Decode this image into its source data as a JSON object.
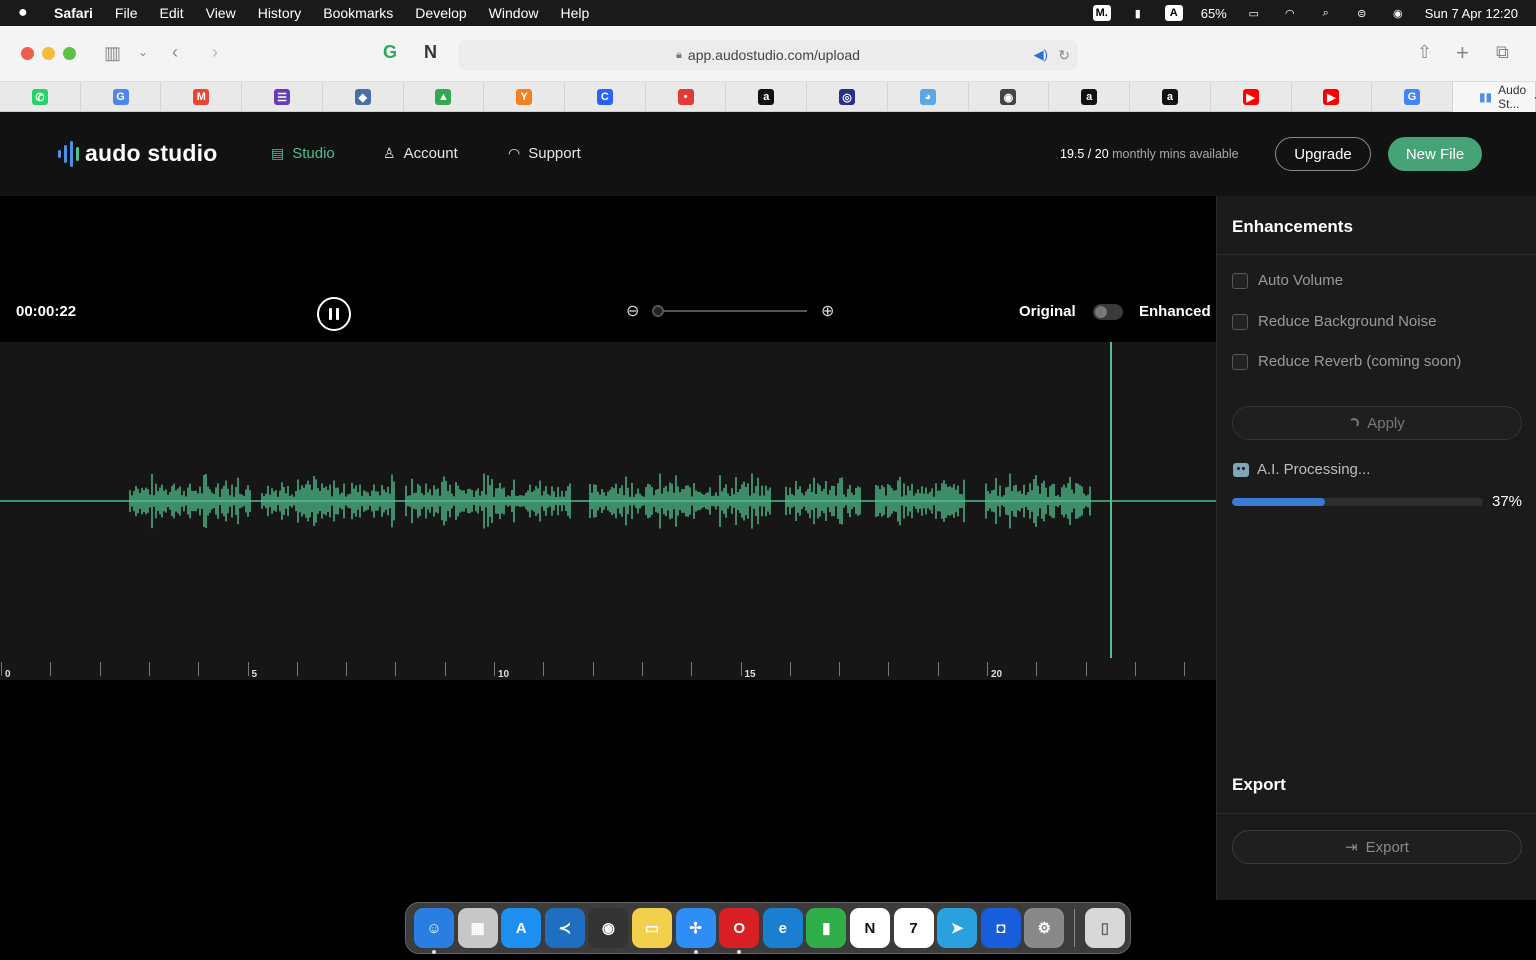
{
  "menubar": {
    "app": "Safari",
    "items": [
      "File",
      "Edit",
      "View",
      "History",
      "Bookmarks",
      "Develop",
      "Window",
      "Help"
    ],
    "battery": "65%",
    "datetime": "Sun 7 Apr  12:20",
    "status_icons": [
      "M.",
      "A"
    ]
  },
  "browser": {
    "url": "app.audostudio.com/upload",
    "active_tab_title": "Audo St...",
    "tab_icons": [
      "whatsapp-icon",
      "translate-icon",
      "gmail-icon",
      "forms-icon",
      "box-icon",
      "drive-icon",
      "y-icon",
      "c-icon",
      "dot-icon",
      "amazon-icon",
      "circle-icon",
      "bird-icon",
      "chat-icon",
      "amazon-icon",
      "amazon-icon",
      "youtube-icon",
      "youtube-icon",
      "google-icon"
    ],
    "tab_glyphs": [
      "✆",
      "G",
      "M",
      "☰",
      "◆",
      "▲",
      "Y",
      "C",
      "•",
      "a",
      "◎",
      "◕",
      "◉",
      "a",
      "a",
      "▶",
      "▶",
      "G"
    ],
    "tab_colors": [
      "#25d366",
      "#4f86ec",
      "#ea4335",
      "#673ab7",
      "#4a6fa5",
      "#34a853",
      "#f48024",
      "#2962ff",
      "#e53935",
      "#111111",
      "#2a2f8f",
      "#5aa7e8",
      "#444444",
      "#111111",
      "#111111",
      "#ff0000",
      "#ff0000",
      "#4285f4"
    ]
  },
  "header": {
    "logo": "audo studio",
    "nav": {
      "studio": "Studio",
      "account": "Account",
      "support": "Support"
    },
    "minutes_used": "19.5 / 20",
    "minutes_text": "monthly mins available",
    "upgrade": "Upgrade",
    "new_file": "New File"
  },
  "player": {
    "timecode": "00:00:22",
    "original": "Original",
    "enhanced": "Enhanced",
    "ticks": [
      "0",
      "5",
      "10",
      "15",
      "20"
    ],
    "playhead_seconds": 22.5,
    "zoom_level": 0
  },
  "sidebar": {
    "enhancements_title": "Enhancements",
    "options": [
      "Auto Volume",
      "Reduce Background Noise",
      "Reduce Reverb (coming soon)"
    ],
    "apply": "Apply",
    "processing": "A.I. Processing...",
    "progress": 0.37,
    "progress_label": "37%",
    "export_title": "Export",
    "export": "Export"
  },
  "dock": {
    "apps": [
      "finder",
      "launchpad",
      "app-store",
      "vscode",
      "obs",
      "notes",
      "safari",
      "opera",
      "edge",
      "numbers",
      "notion",
      "calendar",
      "telegram",
      "bitwarden",
      "system-settings"
    ],
    "glyphs": [
      "☺",
      "▦",
      "A",
      "≺",
      "◉",
      "▭",
      "✢",
      "O",
      "e",
      "▮",
      "N",
      "7",
      "➤",
      "◘",
      "⚙"
    ],
    "colors": [
      "#2a7de1",
      "#c7c7c7",
      "#1c8ff0",
      "#1e6fbf",
      "#333333",
      "#f2d04b",
      "#2f8ef5",
      "#d81f26",
      "#1a7fd0",
      "#2fae4a",
      "#ffffff",
      "#ffffff",
      "#2aa1de",
      "#175ddc",
      "#888888"
    ],
    "trash": "trash"
  },
  "colors": {
    "accent": "#46a277",
    "waveform": "#4fbf8f",
    "progress": "#3a7bd5"
  }
}
